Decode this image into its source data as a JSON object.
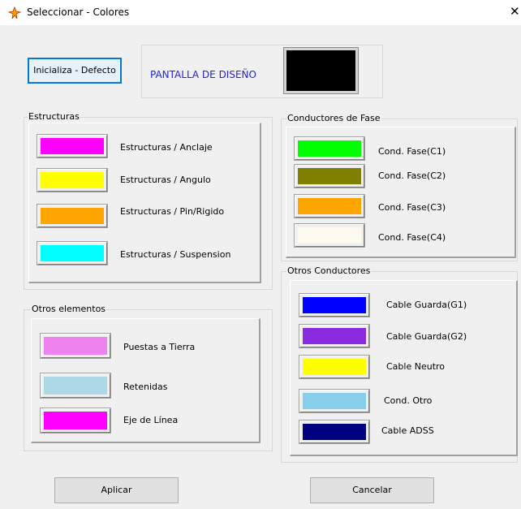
{
  "window": {
    "title": "Seleccionar - Colores",
    "close_glyph": "✕",
    "icon": "app-tower-icon"
  },
  "top": {
    "default_button": "Inicializa - Defecto",
    "preview_label": "PANTALLA DE DISEÑO",
    "preview_color": "#000000",
    "preview_label_color": "#2323d8"
  },
  "estructuras": {
    "title": "Estructuras",
    "items": [
      {
        "label": "Estructuras / Anclaje",
        "color": "#ff00ff"
      },
      {
        "label": "Estructuras / Angulo",
        "color": "#ffff00"
      },
      {
        "label": "Estructuras / Pin/Rigido",
        "color": "#ffa500"
      },
      {
        "label": "Estructuras / Suspension",
        "color": "#00ffff"
      }
    ]
  },
  "otros_elementos": {
    "title": "Otros elementos",
    "items": [
      {
        "label": "Puestas a Tierra",
        "color": "#ee82ee"
      },
      {
        "label": "Retenidas",
        "color": "#add8e6"
      },
      {
        "label": "Eje de Línea",
        "color": "#ff00ff"
      }
    ]
  },
  "conductores_fase": {
    "title": "Conductores de Fase",
    "items": [
      {
        "label": "Cond. Fase(C1)",
        "color": "#00ff00"
      },
      {
        "label": "Cond. Fase(C2)",
        "color": "#808000"
      },
      {
        "label": "Cond. Fase(C3)",
        "color": "#ffa500"
      },
      {
        "label": "Cond. Fase(C4)",
        "color": "#fffaf0"
      }
    ]
  },
  "otros_conductores": {
    "title": "Otros Conductores",
    "items": [
      {
        "label": "Cable Guarda(G1)",
        "color": "#0000ff"
      },
      {
        "label": "Cable Guarda(G2)",
        "color": "#8a2be2"
      },
      {
        "label": "Cable Neutro",
        "color": "#ffff00"
      },
      {
        "label": "Cond. Otro",
        "color": "#87ceeb"
      },
      {
        "label": "Cable ADSS",
        "color": "#000080"
      }
    ]
  },
  "footer": {
    "apply": "Aplicar",
    "cancel": "Cancelar"
  }
}
